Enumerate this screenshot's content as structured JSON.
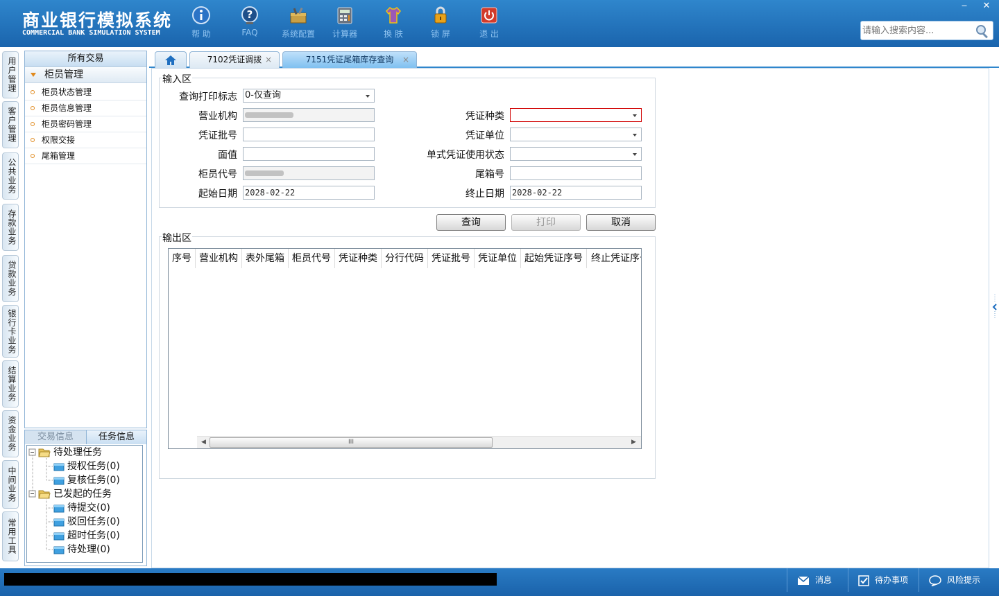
{
  "header": {
    "title": "商业银行模拟系统",
    "subtitle": "COMMERCIAL BANK SIMULATION SYSTEM",
    "toolbar": [
      {
        "label": "帮 助",
        "icon": "info-icon"
      },
      {
        "label": "FAQ",
        "icon": "faq-icon"
      },
      {
        "label": "系统配置",
        "icon": "toolbox-icon"
      },
      {
        "label": "计算器",
        "icon": "calculator-icon"
      },
      {
        "label": "换 肤",
        "icon": "shirt-icon"
      },
      {
        "label": "锁 屏",
        "icon": "lock-icon"
      },
      {
        "label": "退 出",
        "icon": "power-icon"
      }
    ],
    "search_placeholder": "请输入搜索内容..."
  },
  "left_rail": [
    "用户管理",
    "客户管理",
    "公共业务",
    "存款业务",
    "贷款业务",
    "银行卡业务",
    "结算业务",
    "资金业务",
    "中间业务",
    "常用工具"
  ],
  "nav": {
    "header": "所有交易",
    "group": "柜员管理",
    "items": [
      "柜员状态管理",
      "柜员信息管理",
      "柜员密码管理",
      "权限交接",
      "尾箱管理"
    ]
  },
  "tasks": {
    "tab_inactive": "交易信息",
    "tab_active": "任务信息",
    "pending_group": "待处理任务",
    "pending_items": [
      "授权任务(0)",
      "复核任务(0)"
    ],
    "initiated_group": "已发起的任务",
    "initiated_items": [
      "待提交(0)",
      "驳回任务(0)",
      "超时任务(0)",
      "待处理(0)"
    ]
  },
  "tabs": [
    {
      "label": "7102凭证调拨",
      "close": "×"
    },
    {
      "label": "7151凭证尾箱库存查询",
      "close": "×"
    }
  ],
  "form": {
    "input_legend": "输入区",
    "output_legend": "输出区",
    "print_flag_label": "查询打印标志",
    "print_flag_value": "0-仅查询",
    "org_label": "营业机构",
    "voucher_type_label": "凭证种类",
    "batch_label": "凭证批号",
    "unit_label": "凭证单位",
    "face_value_label": "面值",
    "status_label": "单式凭证使用状态",
    "teller_label": "柜员代号",
    "box_label": "尾箱号",
    "start_date_label": "起始日期",
    "start_date_value": "2028-02-22",
    "end_date_label": "终止日期",
    "end_date_value": "2028-02-22"
  },
  "buttons": {
    "query": "查询",
    "print": "打印",
    "cancel": "取消"
  },
  "grid": {
    "columns": [
      "序号",
      "营业机构",
      "表外尾箱",
      "柜员代号",
      "凭证种类",
      "分行代码",
      "凭证批号",
      "凭证单位",
      "起始凭证序号",
      "终止凭证序号"
    ],
    "scroll_grip": "III"
  },
  "statusbar": {
    "messages": "消息",
    "todo": "待办事项",
    "risk": "风险提示"
  },
  "colors": {
    "header_blue": "#1a64ad",
    "accent_orange": "#e08a1e",
    "required_red": "#d00000"
  }
}
